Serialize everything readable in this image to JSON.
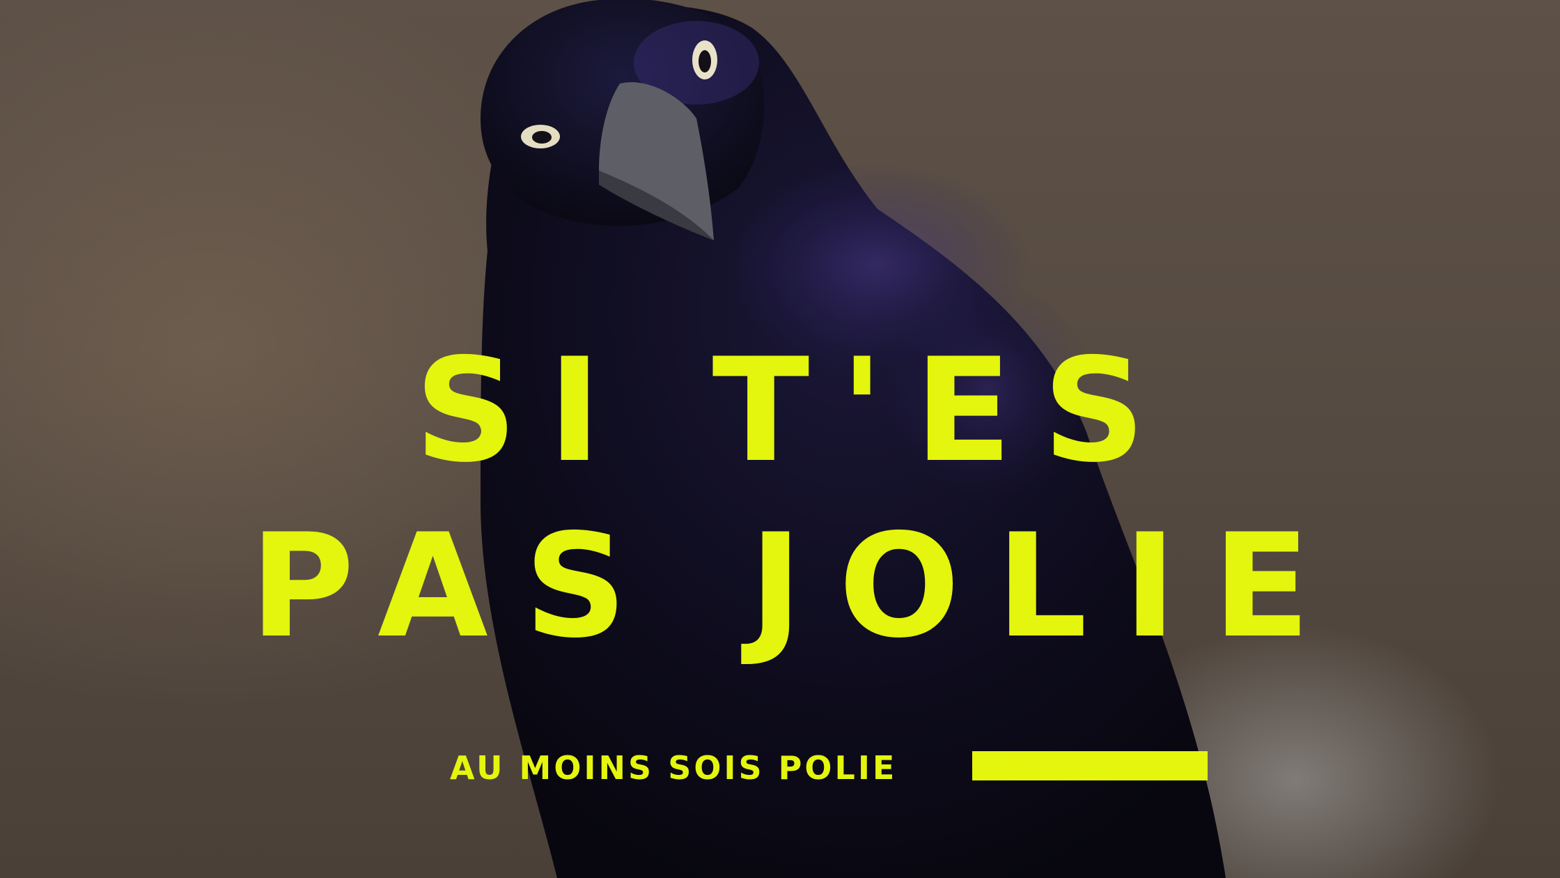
{
  "poster": {
    "headline_line_1": "SI T'ES",
    "headline_line_2": "PAS JOLIE",
    "subtitle": "AU MOINS SOIS POLIE"
  },
  "subject": "common grackle (black bird) looking at camera",
  "colors": {
    "text_accent": "#e4f50e",
    "background": "#564b42",
    "bird_body": "#0e0d1c",
    "bird_iridescence": "#2a2060"
  },
  "icons": {
    "accent_bar": "accent-bar"
  }
}
